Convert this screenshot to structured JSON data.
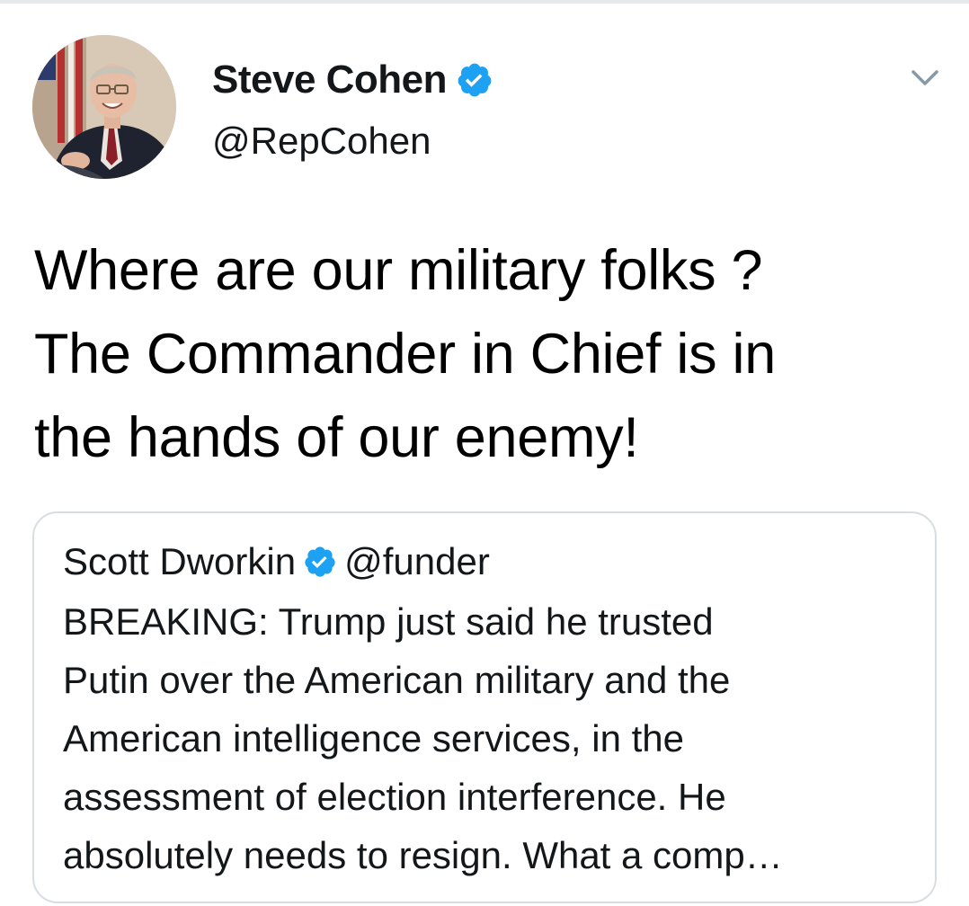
{
  "tweet": {
    "author": {
      "display_name": "Steve Cohen",
      "handle": "@RepCohen",
      "verified_icon": "verified-badge-icon"
    },
    "menu_icon": "chevron-down-icon",
    "text_lines": [
      "Where are our military folks ?",
      "The Commander in Chief is in",
      "the hands of our enemy!"
    ]
  },
  "quoted_tweet": {
    "display_name": "Scott Dworkin",
    "handle": "@funder",
    "verified_icon": "verified-badge-icon",
    "text_lines": [
      "BREAKING: Trump just said he trusted",
      "Putin over the American military and the",
      "American intelligence services, in the",
      "assessment of election interference. He",
      "absolutely needs to resign. What a comp…"
    ]
  },
  "colors": {
    "verified_blue": "#1da1f2",
    "text": "#14171a",
    "card_border": "#d7dde2",
    "caret": "#8899a6"
  }
}
